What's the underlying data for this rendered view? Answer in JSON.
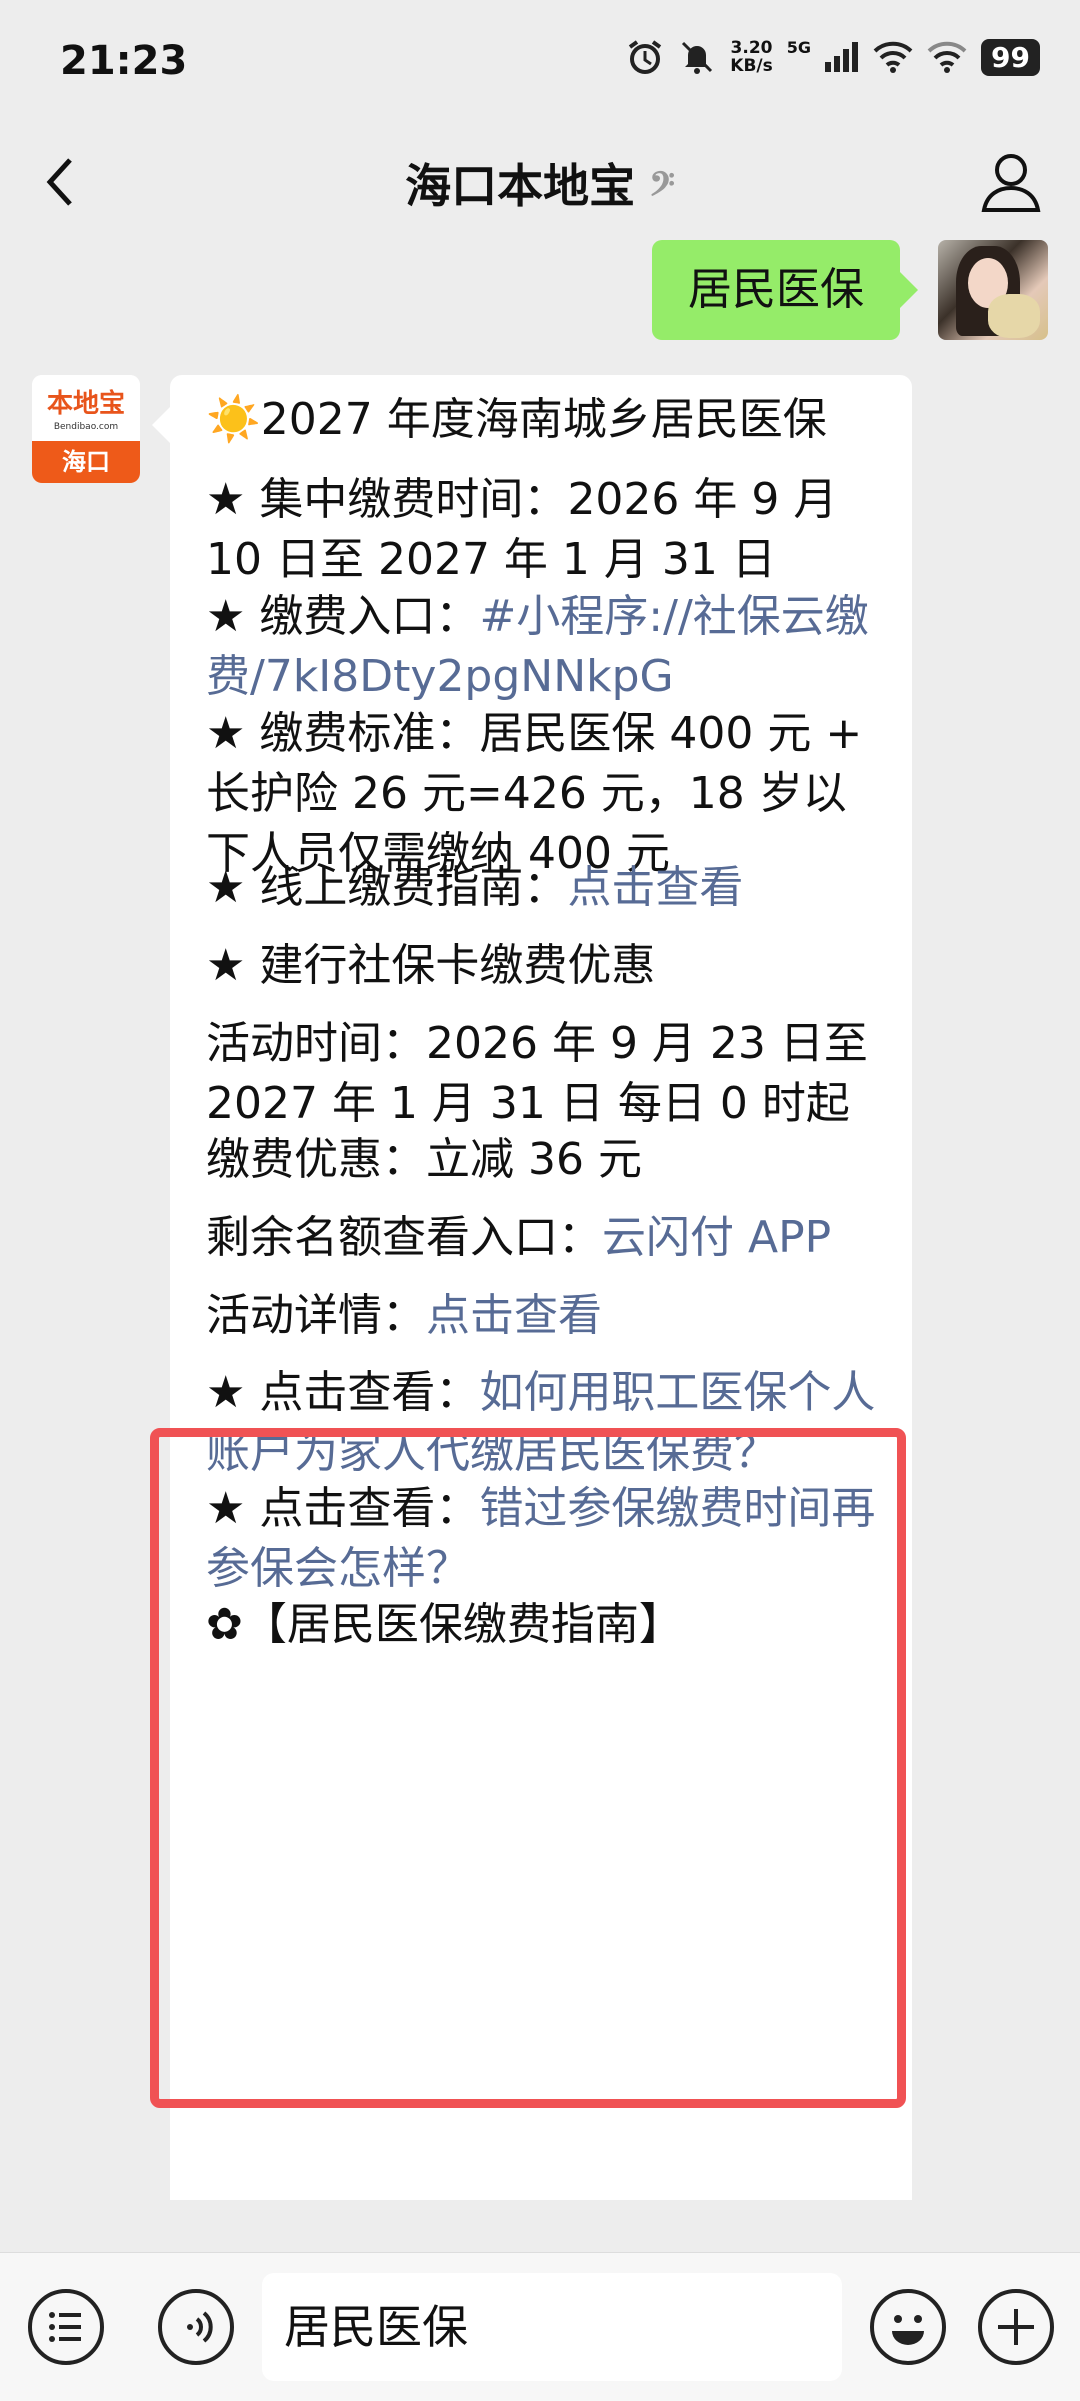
{
  "status_bar": {
    "time": "21:23",
    "net_speed_value": "3.20",
    "net_speed_unit": "KB/s",
    "network": "5G",
    "battery": "99",
    "icons": [
      "alarm-icon",
      "mute-icon",
      "signal-icon",
      "wifi-icon",
      "wifi-icon-2",
      "battery-icon"
    ]
  },
  "nav": {
    "title": "海口本地宝",
    "icons": [
      "back-icon",
      "ear-icon",
      "person-icon"
    ]
  },
  "sent_message": {
    "text": "居民医保"
  },
  "bot": {
    "avatar_logo": "本地宝",
    "avatar_site": "Bendibao.com",
    "avatar_city": "海口"
  },
  "message": {
    "title": "☀️2027 年度海南城乡居民医保",
    "pay_time_label": "★ 集中缴费时间：",
    "pay_time_value": "2026 年 9 月 10 日至 2027 年 1 月 31 日",
    "entry_label": "★ 缴费入口：",
    "entry_link": "#小程序://社保云缴费/7kI8Dty2pgNNkpG",
    "standard_label": "★ 缴费标准：",
    "standard_value": "居民医保 400 元 + 长护险 26 元=426 元，18 岁以下人员仅需缴纳 400 元",
    "guide_label": "★ 线上缴费指南：",
    "guide_link": "点击查看",
    "ccb_title": "★ 建行社保卡缴费优惠",
    "activity_time_label": "活动时间：",
    "activity_time_value": "2026 年 9 月 23 日至 2027 年 1 月 31 日 每日 0 时起",
    "discount_label": "缴费优惠：",
    "discount_value": "立减 36 元",
    "quota_label": "剩余名额查看入口：",
    "quota_link": "云闪付 APP",
    "detail_label": "活动详情：",
    "detail_link": "点击查看",
    "see1_label": "★ 点击查看：",
    "see1_link": "如何用职工医保个人账户为家人代缴居民医保费？",
    "see2_label": "★ 点击查看：",
    "see2_link": "错过参保缴费时间再参保会怎样？",
    "cut_line": "✿【居民医保缴费指南】"
  },
  "colors": {
    "highlight": "#f05254",
    "link": "#576b95",
    "sent_bubble": "#95ec69"
  },
  "input_bar": {
    "text": "居民医保",
    "icons": [
      "menu-icon",
      "voice-icon",
      "emoji-icon",
      "plus-icon"
    ]
  }
}
